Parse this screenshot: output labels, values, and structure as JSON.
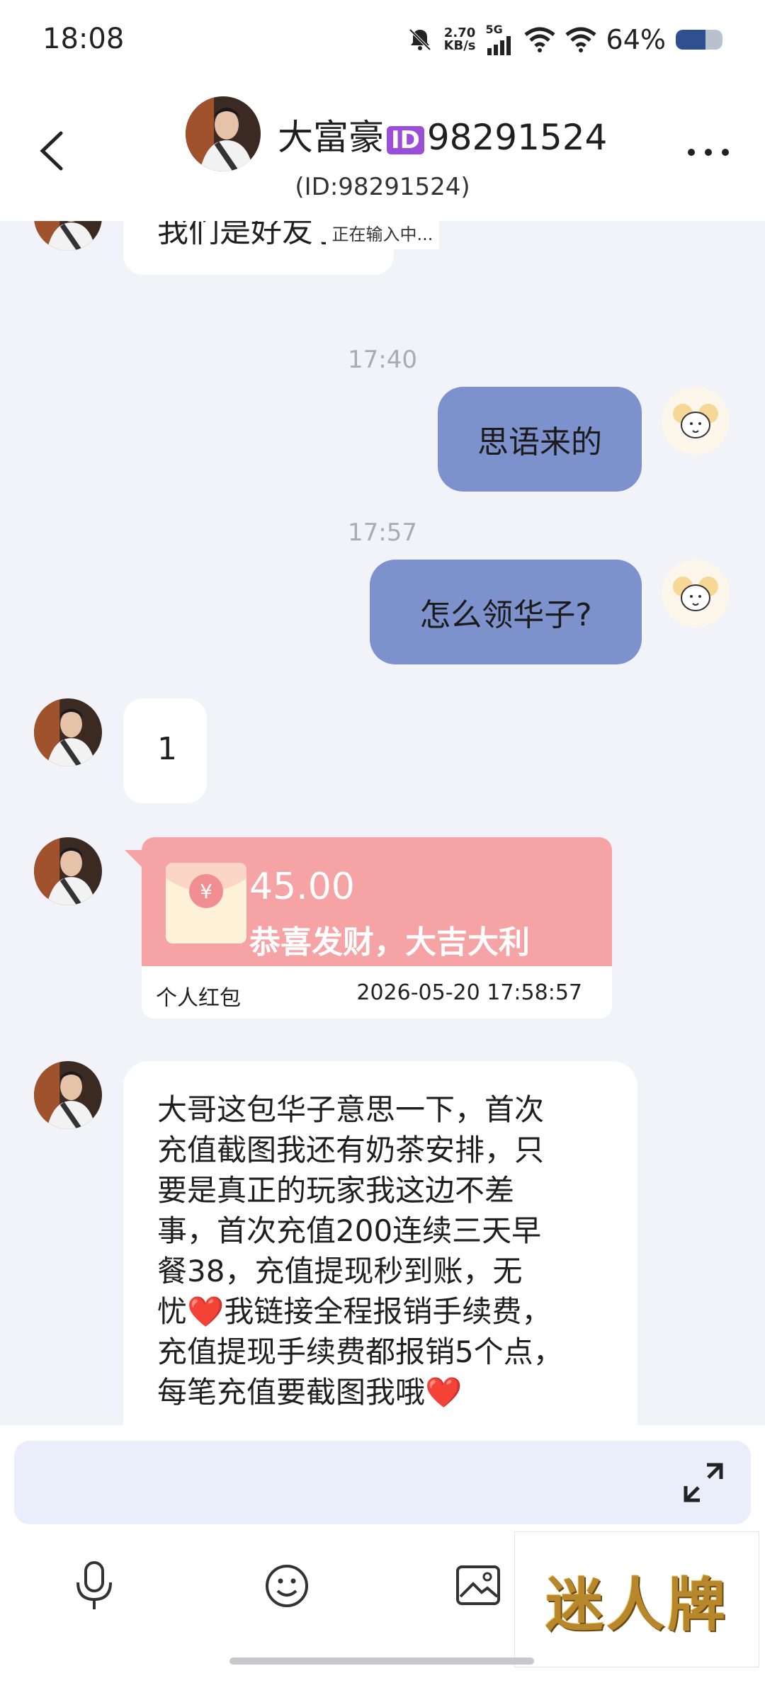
{
  "status_bar": {
    "time": "18:08",
    "net_speed_value": "2.70",
    "net_speed_unit": "KB/s",
    "network": "5G",
    "battery_text": "64%",
    "battery_level": 0.64
  },
  "header": {
    "name_prefix": "大富豪",
    "id_badge": "ID",
    "name_suffix": "98291524",
    "sub_id": "(ID:98291524)",
    "typing": "正在输入中..."
  },
  "messages": {
    "partial_in": "我们是好友了",
    "time_1": "17:40",
    "out_1": "思语来的",
    "time_2": "17:57",
    "out_2": "怎么领华子?",
    "in_1": "1",
    "red_packet": {
      "amount": "45.00",
      "wish": "恭喜发财，大吉大利",
      "label": "个人红包",
      "time": "2026-05-20 17:58:57"
    },
    "long_lines": [
      "大哥这包华子意思一下，首次",
      "充值截图我还有奶茶安排，只",
      "要是真正的玩家我这边不差",
      "事，首次充值200连续三天早",
      "餐38，充值提现秒到账，无",
      "我链接全程报销手续费，",
      "充值提现手续费都报销5个点，",
      "每笔充值要截图我哦"
    ],
    "line6_prefix": "忧",
    "heart": "❤️"
  },
  "bottom": {
    "brand": "迷人牌"
  },
  "colors": {
    "outgoing_bubble": "#7d92cc",
    "red_packet": "#f5a3a5",
    "background": "#f2f3f8"
  },
  "icons": [
    "back-arrow-icon",
    "more-icon",
    "microphone-icon",
    "emoji-icon",
    "image-icon",
    "expand-icon",
    "red-packet-icon"
  ]
}
